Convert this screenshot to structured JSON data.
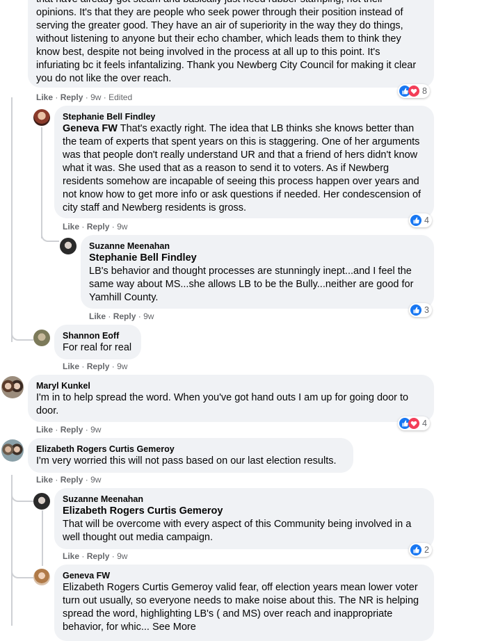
{
  "comments": [
    {
      "id": "c1",
      "text": "that have already got steam and basically just need rubber stamping, not their opinions. It's that they are people who seek power through their position instead of serving the greater good. They have an air of superiority in the way they do things, without listening to anyone but their echo chamber, which leads them to think they know best, despite not being involved in the process at all up to this point. It's infuriating bc it feels infantalizing. Thank you Newberg City Council for making it clear you do not like the over reach.",
      "like": "Like",
      "reply": "Reply",
      "time": "9w",
      "edited": "Edited",
      "reaction_count": "8"
    },
    {
      "id": "c2",
      "author": "Stephanie Bell Findley",
      "mention": "Geneva FW",
      "text": "That's exactly right. The idea that LB thinks she knows better than the team of experts that spent years on this is staggering. One of her arguments was that people don't really understand UR and that a friend of hers didn't know what it was. She used that as a reason to send it to voters. As if Newberg residents somehow are incapable of seeing this process happen over years and not know how to get more info or ask questions if needed. Her condescension of city staff and Newberg residents is gross.",
      "like": "Like",
      "reply": "Reply",
      "time": "9w",
      "reaction_count": "4"
    },
    {
      "id": "c3",
      "author": "Suzanne Meenahan",
      "mention": "Stephanie Bell Findley",
      "text": "LB's behavior and thought processes are stunningly inept...and I feel the same way about MS...she allows LB to be the Bully...neither are good for Yamhill County.",
      "like": "Like",
      "reply": "Reply",
      "time": "9w",
      "reaction_count": "3"
    },
    {
      "id": "c4",
      "author": "Shannon Eoff",
      "text": "For real for real",
      "like": "Like",
      "reply": "Reply",
      "time": "9w"
    },
    {
      "id": "c5",
      "author": "Maryl Kunkel",
      "text": "I'm in to help spread the word. When you've got hand outs I am up for going door to door.",
      "like": "Like",
      "reply": "Reply",
      "time": "9w",
      "reaction_count": "4"
    },
    {
      "id": "c6",
      "author": "Elizabeth Rogers Curtis Gemeroy",
      "text": "I'm very worried this will not pass based on our last election results.",
      "like": "Like",
      "reply": "Reply",
      "time": "9w"
    },
    {
      "id": "c7",
      "author": "Suzanne Meenahan",
      "mention": "Elizabeth Rogers Curtis Gemeroy",
      "text": "That will be overcome with every aspect of this Community being involved in a well thought out media campaign.",
      "like": "Like",
      "reply": "Reply",
      "time": "9w",
      "reaction_count": "2"
    },
    {
      "id": "c8",
      "author": "Geneva FW",
      "text": "Elizabeth Rogers Curtis Gemeroy valid fear, off election years mean lower voter turn out usually, so everyone needs to make noise about this. The NR is helping spread the word, highlighting LB's ( and MS) over reach and inappropriate behavior, for whic... See More"
    }
  ],
  "colors": {
    "bubble": "#f0f2f5",
    "secondary_text": "#65676b",
    "like_blue": "#1877f2",
    "love_red": "#f33e58",
    "thread_line": "#ced0d4"
  },
  "icons": {
    "like": "like-reaction-icon",
    "love": "love-reaction-icon"
  }
}
